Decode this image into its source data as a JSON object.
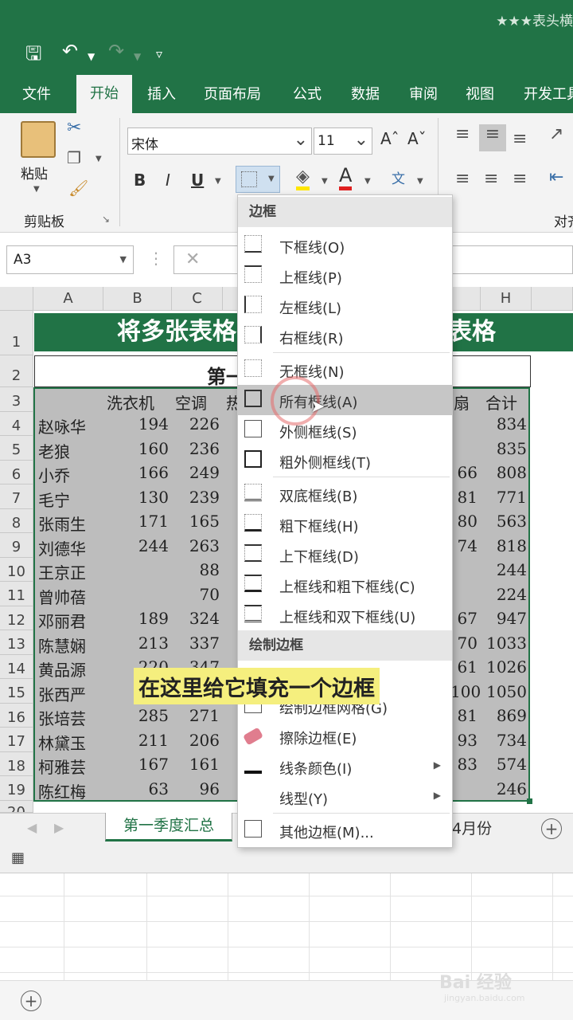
{
  "window": {
    "title": "★★★表头横"
  },
  "tabs": [
    "文件",
    "开始",
    "插入",
    "页面布局",
    "公式",
    "数据",
    "审阅",
    "视图",
    "开发工具"
  ],
  "clipboard": {
    "paste_label": "粘贴",
    "group_label": "剪贴板"
  },
  "font": {
    "name": "宋体",
    "size": "11"
  },
  "align_group_label": "对齐",
  "name_box": {
    "value": "A3"
  },
  "columns": [
    "A",
    "B",
    "C",
    "H"
  ],
  "rows": [
    "1",
    "2",
    "3",
    "4",
    "5",
    "6",
    "7",
    "8",
    "9",
    "10",
    "11",
    "12",
    "13",
    "14",
    "15",
    "16",
    "17",
    "18",
    "19",
    "20"
  ],
  "sheet": {
    "banner_left": "将多张表格",
    "banner_right": "表格",
    "row2_title": "第一",
    "headers": {
      "b": "洗衣机",
      "c": "空调",
      "d": "热",
      "g": "扇",
      "h": "合计"
    },
    "data": [
      {
        "name": "赵咏华",
        "b": "194",
        "c": "226",
        "g": "",
        "h": "834"
      },
      {
        "name": "老狼",
        "b": "160",
        "c": "236",
        "g": "",
        "h": "835"
      },
      {
        "name": "小乔",
        "b": "166",
        "c": "249",
        "g": "66",
        "h": "808"
      },
      {
        "name": "毛宁",
        "b": "130",
        "c": "239",
        "g": "81",
        "h": "771"
      },
      {
        "name": "张雨生",
        "b": "171",
        "c": "165",
        "g": "80",
        "h": "563"
      },
      {
        "name": "刘德华",
        "b": "244",
        "c": "263",
        "g": "74",
        "h": "818"
      },
      {
        "name": "王京正",
        "b": "",
        "c": "88",
        "g": "",
        "h": "244"
      },
      {
        "name": "曾帅蓓",
        "b": "",
        "c": "70",
        "g": "",
        "h": "224"
      },
      {
        "name": "邓丽君",
        "b": "189",
        "c": "324",
        "g": "67",
        "h": "947"
      },
      {
        "name": "陈慧娴",
        "b": "213",
        "c": "337",
        "g": "70",
        "h": "1033"
      },
      {
        "name": "黄品源",
        "b": "220",
        "c": "347",
        "g": "61",
        "h": "1026"
      },
      {
        "name": "张西严",
        "b": "",
        "c": "",
        "g": "100",
        "h": "1050"
      },
      {
        "name": "张培芸",
        "b": "285",
        "c": "271",
        "g": "81",
        "h": "869"
      },
      {
        "name": "林黛玉",
        "b": "211",
        "c": "206",
        "g": "93",
        "h": "734"
      },
      {
        "name": "柯雅芸",
        "b": "167",
        "c": "161",
        "g": "83",
        "h": "574"
      },
      {
        "name": "陈红梅",
        "b": "63",
        "c": "96",
        "g": "",
        "h": "246"
      }
    ]
  },
  "sheet_tabs": {
    "active": "第一季度汇总",
    "other": "4月份"
  },
  "border_menu": {
    "section1": "边框",
    "items1": [
      "下框线(O)",
      "上框线(P)",
      "左框线(L)",
      "右框线(R)",
      "无框线(N)",
      "所有框线(A)",
      "外侧框线(S)",
      "粗外侧框线(T)",
      "双底框线(B)",
      "粗下框线(H)",
      "上下框线(D)",
      "上框线和粗下框线(C)",
      "上框线和双下框线(U)"
    ],
    "section2": "绘制边框",
    "items2": [
      "绘制边框网格(G)",
      "擦除边框(E)",
      "线条颜色(I)",
      "线型(Y)",
      "其他边框(M)..."
    ]
  },
  "caption": "在这里给它填充一个边框",
  "watermark": {
    "brand": "Bai 经验",
    "url": "jingyan.baidu.com"
  },
  "colors": {
    "excel_green": "#217346",
    "caption_bg": "#f5ef7e"
  }
}
